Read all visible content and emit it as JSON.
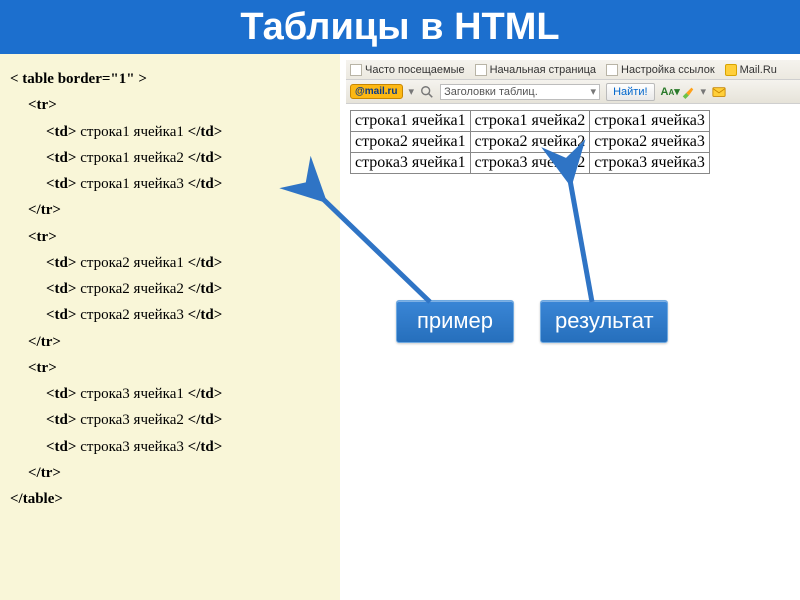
{
  "header": {
    "title": "Таблицы в HTML"
  },
  "code": {
    "lines": [
      {
        "indent": 0,
        "tag_open": "< table border=\"1\" >",
        "text": "",
        "tag_close": ""
      },
      {
        "indent": 1,
        "tag_open": "<tr>",
        "text": "",
        "tag_close": ""
      },
      {
        "indent": 2,
        "tag_open": "<td>",
        "text": " строка1 ячейка1 ",
        "tag_close": "</td>"
      },
      {
        "indent": 2,
        "tag_open": "<td>",
        "text": " строка1 ячейка2 ",
        "tag_close": "</td>"
      },
      {
        "indent": 2,
        "tag_open": "<td>",
        "text": " строка1 ячейка3 ",
        "tag_close": "</td>"
      },
      {
        "indent": 1,
        "tag_open": "</tr>",
        "text": "",
        "tag_close": ""
      },
      {
        "indent": 1,
        "tag_open": "<tr>",
        "text": "",
        "tag_close": ""
      },
      {
        "indent": 2,
        "tag_open": "<td>",
        "text": " строка2 ячейка1 ",
        "tag_close": "</td>"
      },
      {
        "indent": 2,
        "tag_open": "<td>",
        "text": " строка2 ячейка2 ",
        "tag_close": "</td>"
      },
      {
        "indent": 2,
        "tag_open": "<td>",
        "text": " строка2 ячейка3 ",
        "tag_close": "</td>"
      },
      {
        "indent": 1,
        "tag_open": "</tr>",
        "text": "",
        "tag_close": ""
      },
      {
        "indent": 1,
        "tag_open": "<tr>",
        "text": "",
        "tag_close": ""
      },
      {
        "indent": 2,
        "tag_open": "<td>",
        "text": " строка3 ячейка1 ",
        "tag_close": "</td>"
      },
      {
        "indent": 2,
        "tag_open": "<td>",
        "text": " строка3 ячейка2 ",
        "tag_close": "</td>"
      },
      {
        "indent": 2,
        "tag_open": "<td>",
        "text": " строка3 ячейка3 ",
        "tag_close": "</td>"
      },
      {
        "indent": 1,
        "tag_open": "</tr>",
        "text": "",
        "tag_close": ""
      },
      {
        "indent": 0,
        "tag_open": "</table>",
        "text": "",
        "tag_close": ""
      }
    ]
  },
  "browser": {
    "bookmarks": [
      "Часто посещаемые",
      "Начальная страница",
      "Настройка ссылок",
      "Mail.Ru"
    ],
    "logo_text": "@mail.ru",
    "search_value": "Заголовки таблиц.",
    "find_label": "Найти!"
  },
  "result": {
    "rows": [
      [
        "строка1 ячейка1",
        "строка1 ячейка2",
        "строка1 ячейка3"
      ],
      [
        "строка2 ячейка1",
        "строка2 ячейка2",
        "строка2 ячейка3"
      ],
      [
        "строка3 ячейка1",
        "строка3 ячейка2",
        "строка3 ячейка3"
      ]
    ]
  },
  "callouts": {
    "example": "пример",
    "result": "результат"
  }
}
